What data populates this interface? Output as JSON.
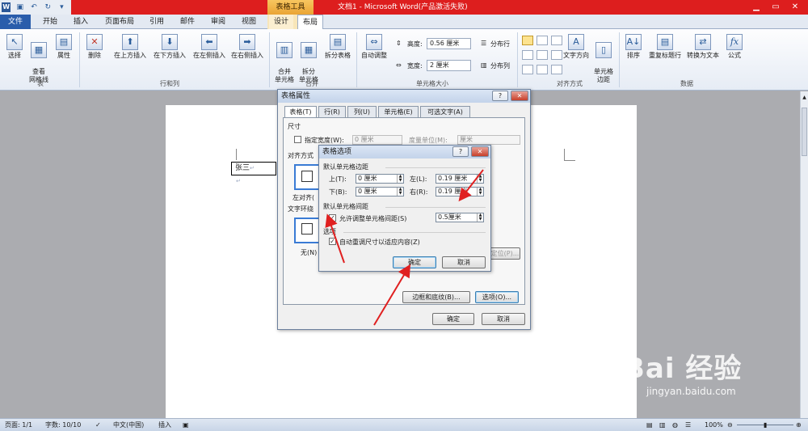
{
  "titlebar": {
    "context_label": "表格工具",
    "window_title": "文档1 - Microsoft Word(产品激活失败)",
    "qat_icons": [
      "word-icon",
      "save-icon",
      "undo-icon",
      "redo-icon",
      "customize-icon"
    ]
  },
  "tabs": [
    "文件",
    "开始",
    "插入",
    "页面布局",
    "引用",
    "邮件",
    "审阅",
    "视图",
    "设计",
    "布局"
  ],
  "ribbon": {
    "table_group": {
      "label": "表",
      "select": "选择",
      "gridlines": "查看\n网格线",
      "properties": "属性"
    },
    "rows_cols_group": {
      "label": "行和列",
      "delete": "删除",
      "insert_above": "在上方插入",
      "insert_below": "在下方插入",
      "insert_left": "在左侧插入",
      "insert_right": "在右侧插入"
    },
    "merge_group": {
      "label": "合并",
      "merge": "合并\n单元格",
      "split_cells": "拆分\n单元格",
      "split_table": "拆分表格"
    },
    "cell_size_group": {
      "label": "单元格大小",
      "autofit": "自动调整",
      "height_label": "高度:",
      "height_value": "0.56 厘米",
      "width_label": "宽度:",
      "width_value": "2 厘米",
      "distribute_rows": "分布行",
      "distribute_cols": "分布列"
    },
    "alignment_group": {
      "label": "对齐方式",
      "text_direction": "文字方向",
      "cell_margins": "单元格\n边距"
    },
    "data_group": {
      "label": "数据",
      "sort": "排序",
      "repeat_header": "重复标题行",
      "convert_text": "转换为文本",
      "formula": "公式"
    }
  },
  "document": {
    "cell_text": "张三"
  },
  "statusbar": {
    "page": "页面: 1/1",
    "words": "字数: 10/10",
    "language": "中文(中国)",
    "mode": "插入",
    "zoom": "100%"
  },
  "table_properties": {
    "title": "表格属性",
    "tabs": [
      "表格(T)",
      "行(R)",
      "列(U)",
      "单元格(E)",
      "可选文字(A)"
    ],
    "size_section": "尺寸",
    "specify_width": "指定宽度(W):",
    "width_value": "0 厘米",
    "measure_in": "度量单位(M):",
    "measure_value": "厘米",
    "alignment_section": "对齐方式",
    "align_left": "左对齐(",
    "wrap_section": "文字环绕",
    "wrap_none": "无(N)",
    "positioning": "定位(P)...",
    "borders_button": "边框和底纹(B)...",
    "options_button": "选项(O)...",
    "ok": "确定",
    "cancel": "取消"
  },
  "table_options": {
    "title": "表格选项",
    "margins_section": "默认单元格边距",
    "top_label": "上(T):",
    "top_value": "0 厘米",
    "left_label": "左(L):",
    "left_value": "0.19 厘米",
    "bottom_label": "下(B):",
    "bottom_value": "0 厘米",
    "right_label": "右(R):",
    "right_value": "0.19 厘米",
    "spacing_section": "默认单元格间距",
    "allow_spacing": "允许调整单元格间距(S)",
    "spacing_value": "0.5厘米",
    "options_section": "选项",
    "auto_resize": "自动重调尺寸以适应内容(Z)",
    "ok": "确定",
    "cancel": "取消"
  },
  "watermark": {
    "logo": "Bai 经验",
    "url": "jingyan.baidu.com"
  },
  "colors": {
    "titlebar": "#dd1e1e",
    "file_tab": "#2a5dab",
    "context_tab": "#f7c65f",
    "arrow": "#e02020"
  }
}
